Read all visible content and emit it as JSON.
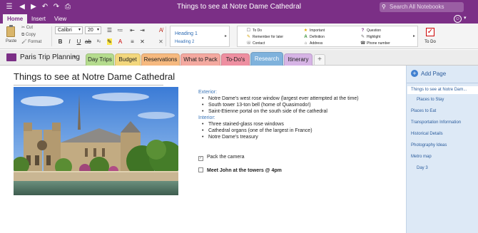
{
  "window": {
    "title": "Things to see at Notre Dame Cathedral",
    "search_placeholder": "Search All Notebooks"
  },
  "ribbon": {
    "tabs": [
      {
        "label": "Home",
        "active": true
      },
      {
        "label": "Insert",
        "active": false
      },
      {
        "label": "View",
        "active": false
      }
    ],
    "clipboard": {
      "paste": "Paste",
      "cut": "Cut",
      "copy": "Copy",
      "format": "Format"
    },
    "font": {
      "name": "Calibri",
      "size": "20"
    },
    "styles": {
      "heading1": "Heading 1",
      "heading2": "Heading 2"
    },
    "tags": {
      "col1": [
        "To Do",
        "Remember for later",
        "Contact"
      ],
      "col2": [
        "Important",
        "Definition",
        "Address"
      ],
      "col3": [
        "Question",
        "Highlight",
        "Phone number"
      ]
    },
    "todo_button": "To Do"
  },
  "notebook": {
    "name": "Paris Trip Planning",
    "sections": [
      {
        "label": "Day Trips",
        "color": "#b5dc8e"
      },
      {
        "label": "Budget",
        "color": "#f3d77d"
      },
      {
        "label": "Reservations",
        "color": "#f6b97f"
      },
      {
        "label": "What to Pack",
        "color": "#f4a9a0"
      },
      {
        "label": "To-Do's",
        "color": "#ee8fa1"
      },
      {
        "label": "Research",
        "color": "#7fb2dc",
        "active": true
      },
      {
        "label": "Itinerary",
        "color": "#d6b4e5"
      }
    ]
  },
  "page": {
    "title": "Things to see at Notre Dame Cathedral",
    "exterior_header": "Exterior:",
    "exterior_items": [
      "Notre Dame's west rose window (largest ever attempted at the time)",
      "South tower 13-ton bell (home of Quasimodo!)",
      "Saint-Etienne portal on the south side of the cathedral"
    ],
    "interior_header": "Interior:",
    "interior_items": [
      "Three stained-glass rose windows",
      "Cathedral organs (one of the largest in France)",
      "Notre Dame's treasury"
    ],
    "todos": [
      {
        "text": "Pack the camera",
        "checked": true
      },
      {
        "text": "Meet John at the towers @ 4pm",
        "checked": false
      }
    ]
  },
  "page_pane": {
    "add_page": "Add Page",
    "pages": [
      {
        "label": "Things to see at Notre Dam...",
        "selected": true,
        "indent": 0
      },
      {
        "label": "Places to Stay",
        "indent": 1
      },
      {
        "label": "Places to Eat",
        "indent": 0
      },
      {
        "label": "Transportation Information",
        "indent": 0
      },
      {
        "label": "Historical Details",
        "indent": 0
      },
      {
        "label": "Photography Ideas",
        "indent": 0
      },
      {
        "label": "Metro map",
        "indent": 0
      },
      {
        "label": "Day 3",
        "indent": 1
      }
    ]
  },
  "colors": {
    "brand": "#7b2f86",
    "page_pane_bg": "#dde9f6",
    "link_blue": "#2b5c9c"
  }
}
